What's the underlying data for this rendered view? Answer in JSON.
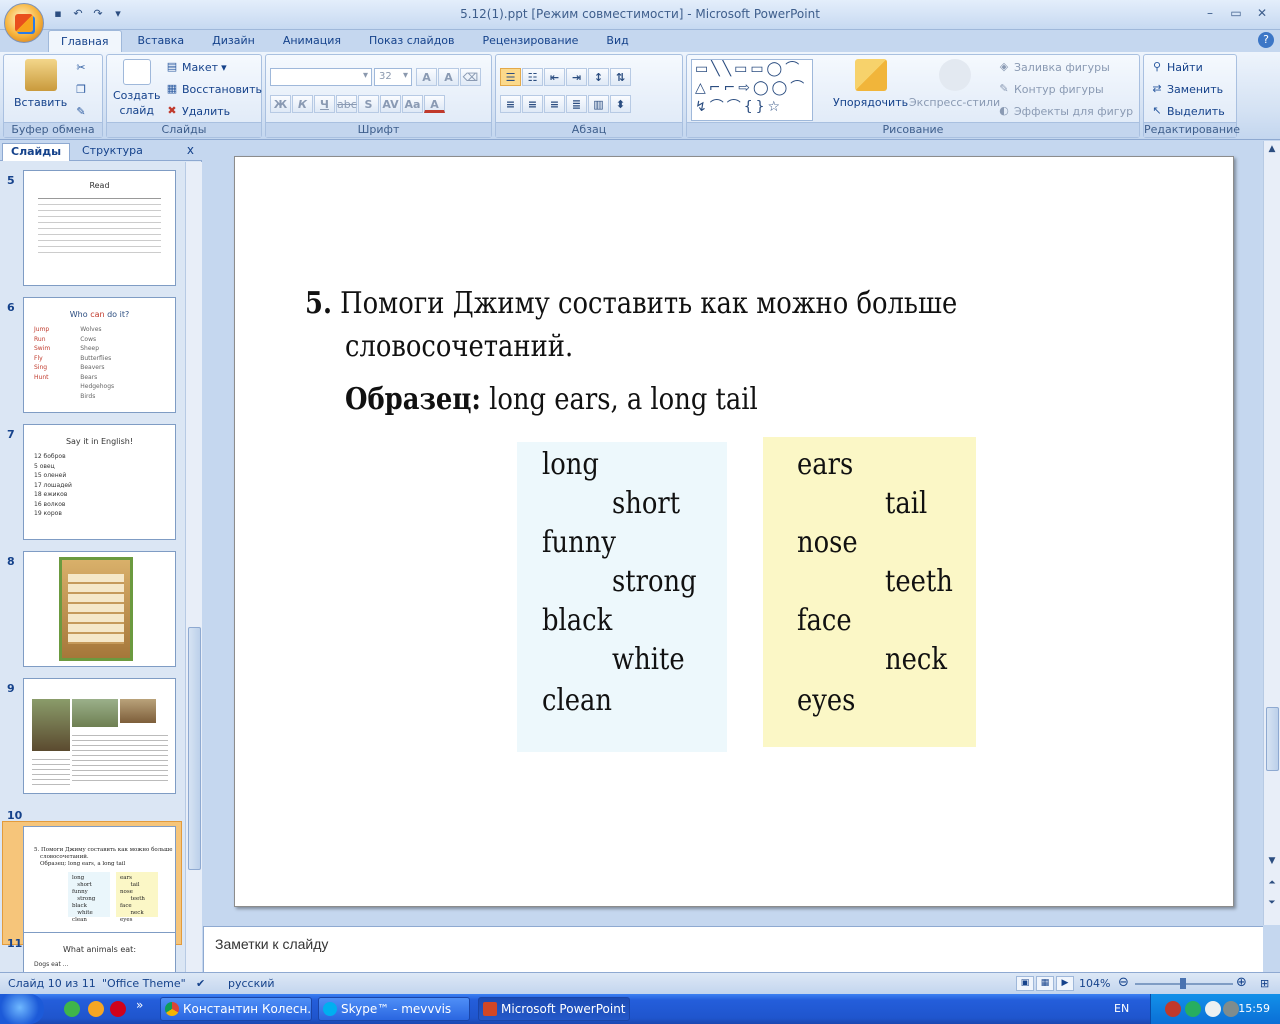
{
  "window": {
    "title": "5.12(1).ppt [Режим совместимости] - Microsoft PowerPoint",
    "controls": [
      "–",
      "▭",
      "✕"
    ]
  },
  "ribbon": {
    "tabs": [
      "Главная",
      "Вставка",
      "Дизайн",
      "Анимация",
      "Показ слайдов",
      "Рецензирование",
      "Вид"
    ],
    "clipboard": {
      "paste": "Вставить",
      "label": "Буфер обмена"
    },
    "slides": {
      "create": "Создать",
      "create2": "слайд",
      "layout": "Макет",
      "reset": "Восстановить",
      "delete": "Удалить",
      "label": "Слайды"
    },
    "font": {
      "size": "32",
      "label": "Шрифт"
    },
    "paragraph": {
      "label": "Абзац"
    },
    "drawing": {
      "arrange": "Упорядочить",
      "styles": "Экспресс-стили",
      "fill": "Заливка фигуры",
      "outline": "Контур фигуры",
      "effects": "Эффекты для фигур",
      "label": "Рисование"
    },
    "editing": {
      "find": "Найти",
      "replace": "Заменить",
      "select": "Выделить",
      "label": "Редактирование"
    }
  },
  "left_panel": {
    "tab_slides": "Слайды",
    "tab_outline": "Структура",
    "close": "x",
    "thumbs": [
      {
        "num": "5",
        "title": "Read"
      },
      {
        "num": "6",
        "title_a": "Who ",
        "title_b": "can",
        "title_c": " do it?",
        "left": [
          "Jump",
          "Run",
          "Swim",
          "Fly",
          "Sing",
          "Hunt"
        ],
        "right": [
          "Wolves",
          "Cows",
          "Sheep",
          "Butterflies",
          "Beavers",
          "Bears",
          "Hedgehogs",
          "Birds"
        ]
      },
      {
        "num": "7",
        "title": "Say it in English!",
        "items": [
          "12 бобров",
          "5 овец",
          "15 оленей",
          "17 лошадей",
          "18 ежиков",
          "16 волков",
          "19 коров"
        ]
      },
      {
        "num": "8"
      },
      {
        "num": "9"
      },
      {
        "num": "10",
        "line1": "5. Помоги Джиму составить как можно больше",
        "line2": "словосочетаний.",
        "line3": "Образец: long ears, a long tail"
      },
      {
        "num": "11",
        "title": "What animals eat:",
        "item": "Dogs eat ..."
      }
    ]
  },
  "slide": {
    "task_number": "5.",
    "task_line1": "Помоги Джиму составить как можно больше",
    "task_line2": "словосочетаний.",
    "sample_label": "Образец:",
    "sample_text": " long ears, a long tail",
    "adjectives": [
      "long",
      "short",
      "funny",
      "strong",
      "black",
      "white",
      "clean"
    ],
    "nouns": [
      "ears",
      "tail",
      "nose",
      "teeth",
      "face",
      "neck",
      "eyes"
    ]
  },
  "notes": {
    "placeholder": "Заметки к слайду"
  },
  "status": {
    "slide_count": "Слайд 10 из 11",
    "theme": "\"Office Theme\"",
    "language": "русский",
    "zoom": "104%"
  },
  "taskbar": {
    "items": [
      "Константин Колесн...",
      "Skype™ - mevvvis",
      "Microsoft PowerPoint ..."
    ],
    "lang": "EN",
    "time": "15:59"
  },
  "colors": {
    "accent": "#f7b35b",
    "ribbon": "#dde8f6",
    "taskbar": "#245edb"
  }
}
